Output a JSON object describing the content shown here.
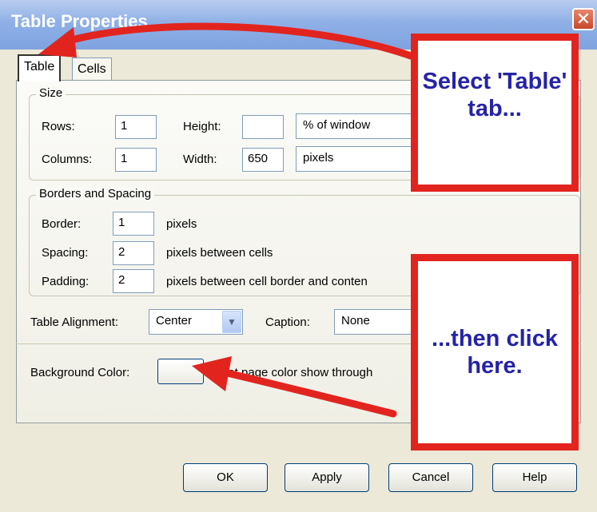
{
  "window": {
    "title": "Table Properties",
    "close_glyph": "✕"
  },
  "tabs": [
    {
      "label": "Table",
      "active": true
    },
    {
      "label": "Cells",
      "active": false
    }
  ],
  "size_group": {
    "title": "Size",
    "rows_label": "Rows:",
    "rows_value": "1",
    "columns_label": "Columns:",
    "columns_value": "1",
    "height_label": "Height:",
    "height_value": "",
    "height_unit": "% of window",
    "width_label": "Width:",
    "width_value": "650",
    "width_unit": "pixels"
  },
  "borders_group": {
    "title": "Borders and Spacing",
    "border_label": "Border:",
    "border_value": "1",
    "border_suffix": "pixels",
    "spacing_label": "Spacing:",
    "spacing_value": "2",
    "spacing_suffix": "pixels between cells",
    "padding_label": "Padding:",
    "padding_value": "2",
    "padding_suffix": "pixels between cell border and conten"
  },
  "alignment": {
    "label": "Table Alignment:",
    "value": "Center",
    "caption_label": "Caption:",
    "caption_value": "None"
  },
  "background": {
    "label": "Background Color:",
    "hint": "(Let page color show through"
  },
  "buttons": {
    "ok": "OK",
    "apply": "Apply",
    "cancel": "Cancel",
    "help": "Help"
  },
  "callouts": {
    "top": "Select 'Table' tab...",
    "bottom": "...then click here."
  },
  "colors": {
    "callout_border": "#e2241f",
    "callout_text": "#2523a6",
    "titlebar": "#8fb0e6",
    "dialog_bg": "#ece9d8"
  }
}
